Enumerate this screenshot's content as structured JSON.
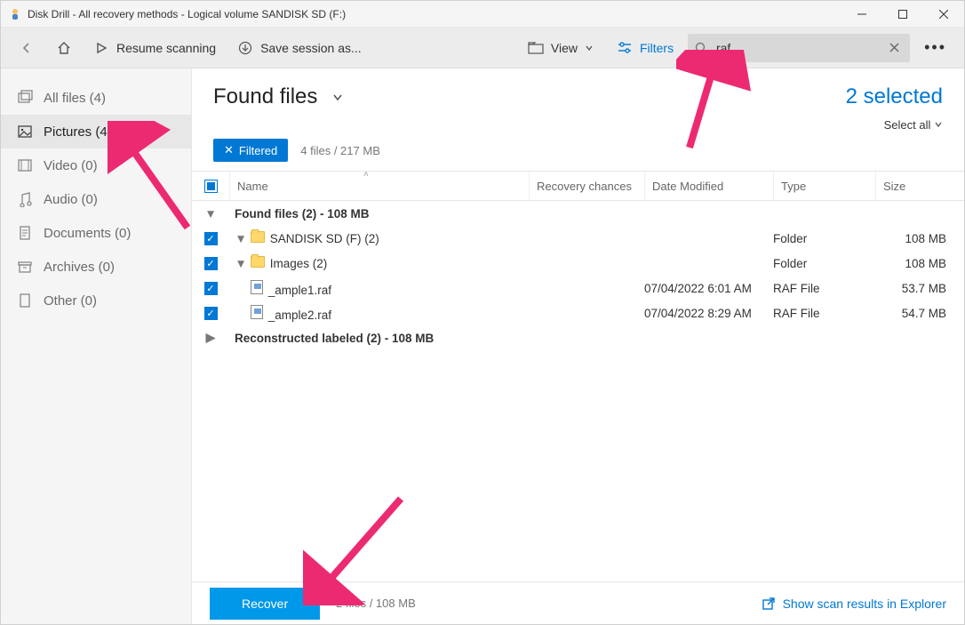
{
  "window": {
    "title": "Disk Drill - All recovery methods - Logical volume SANDISK SD (F:)"
  },
  "toolbar": {
    "resume": "Resume scanning",
    "save_session": "Save session as...",
    "view": "View",
    "filters": "Filters"
  },
  "search": {
    "value": ".raf"
  },
  "sidebar": {
    "items": [
      {
        "label": "All files (4)"
      },
      {
        "label": "Pictures (4)"
      },
      {
        "label": "Video (0)"
      },
      {
        "label": "Audio (0)"
      },
      {
        "label": "Documents (0)"
      },
      {
        "label": "Archives (0)"
      },
      {
        "label": "Other (0)"
      }
    ]
  },
  "header": {
    "title": "Found files",
    "selected": "2 selected",
    "select_all": "Select all",
    "filtered_label": "Filtered",
    "file_summary": "4 files / 217 MB"
  },
  "columns": {
    "name": "Name",
    "recovery": "Recovery chances",
    "date": "Date Modified",
    "type": "Type",
    "size": "Size"
  },
  "rows": {
    "group1": "Found files (2) - 108 MB",
    "folder1": {
      "name": "SANDISK SD (F) (2)",
      "type": "Folder",
      "size": "108 MB"
    },
    "folder2": {
      "name": "Images (2)",
      "type": "Folder",
      "size": "108 MB"
    },
    "file1": {
      "name": "_ample1.raf",
      "date": "07/04/2022 6:01 AM",
      "type": "RAF File",
      "size": "53.7 MB"
    },
    "file2": {
      "name": "_ample2.raf",
      "date": "07/04/2022 8:29 AM",
      "type": "RAF File",
      "size": "54.7 MB"
    },
    "group2": "Reconstructed labeled (2) - 108 MB"
  },
  "footer": {
    "recover": "Recover",
    "summary": "2 files / 108 MB",
    "explorer": "Show scan results in Explorer"
  }
}
